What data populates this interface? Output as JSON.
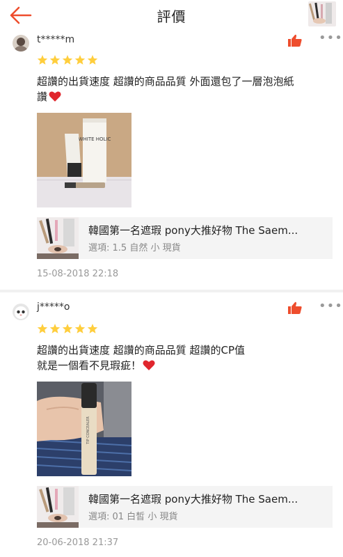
{
  "header": {
    "title": "評價",
    "back_icon": "arrow-left-icon",
    "accent_color": "#ee4d2d"
  },
  "reviews": [
    {
      "username": "t*****m",
      "rating": 5,
      "comment_line1": " 超讚的出貨速度 超讚的商品品質 外面還包了一層泡泡紙",
      "comment_line2": "讚",
      "product_name": "韓國第一名遮瑕 pony大推好物 The Saem...",
      "product_option": "選項: 1.5 自然 小 現貨",
      "date": "15-08-2018 22:18",
      "photo_text": "WHITE HOLIC"
    },
    {
      "username": "j*****o",
      "rating": 5,
      "comment_line1": " 超讚的出貨速度 超讚的商品品質 超讚的CP值",
      "comment_line2": "就是一個看不見瑕疵！",
      "product_name": "韓國第一名遮瑕 pony大推好物 The Saem...",
      "product_option": "選項: 01 白皙 小 現貨",
      "date": "20-06-2018 21:37",
      "photo_text": "TIP CONCEALER"
    }
  ],
  "colors": {
    "star": "#ffce3d",
    "like": "#ee4d2d",
    "heart": "#e0262d"
  }
}
